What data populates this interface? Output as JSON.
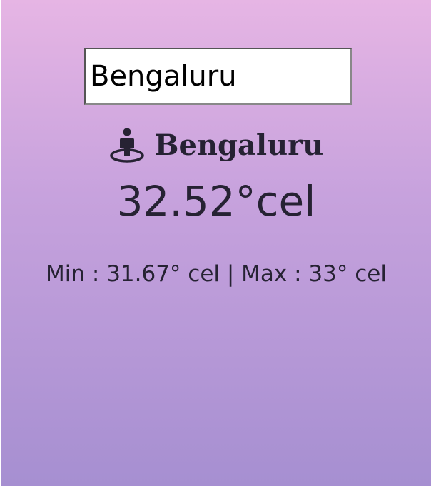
{
  "search": {
    "value": "Bengaluru"
  },
  "weather": {
    "city_icon": "person-pin-icon",
    "city": "Bengaluru",
    "temperature": "32.52°cel",
    "min_max": "Min : 31.67° cel | Max : 33° cel"
  },
  "colors": {
    "gradient_top": "#e6b5e4",
    "gradient_bottom": "#a68fd1",
    "text": "#262233"
  }
}
